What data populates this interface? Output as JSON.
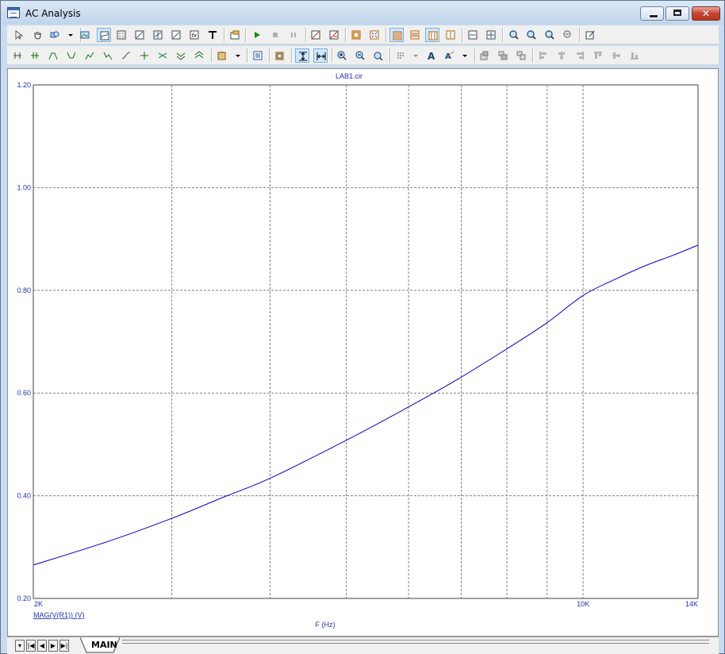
{
  "window": {
    "title": "AC Analysis"
  },
  "tabs": [
    {
      "label": "MAIN"
    }
  ],
  "chart_data": {
    "type": "line",
    "title": "LAB1.cir",
    "xlabel": "F (Hz)",
    "ylabel": "",
    "x_scale": "log",
    "xlim": [
      2000,
      14000
    ],
    "ylim": [
      0.2,
      1.2
    ],
    "x_tick_labels": [
      "2K",
      "10K",
      "14K"
    ],
    "y_tick_labels": [
      "0.20",
      "0.40",
      "0.60",
      "0.80",
      "1.00",
      "1.20"
    ],
    "grid": true,
    "series": [
      {
        "name": "MAG(V(R1)) (V)",
        "color": "#0000c8",
        "x": [
          2000,
          2500,
          3000,
          3500,
          4000,
          5000,
          6000,
          7000,
          8000,
          9000,
          10000,
          11000,
          12000,
          13000,
          14000
        ],
        "y": [
          0.265,
          0.312,
          0.356,
          0.398,
          0.434,
          0.508,
          0.573,
          0.631,
          0.686,
          0.737,
          0.79,
          0.822,
          0.848,
          0.868,
          0.888
        ]
      }
    ]
  }
}
